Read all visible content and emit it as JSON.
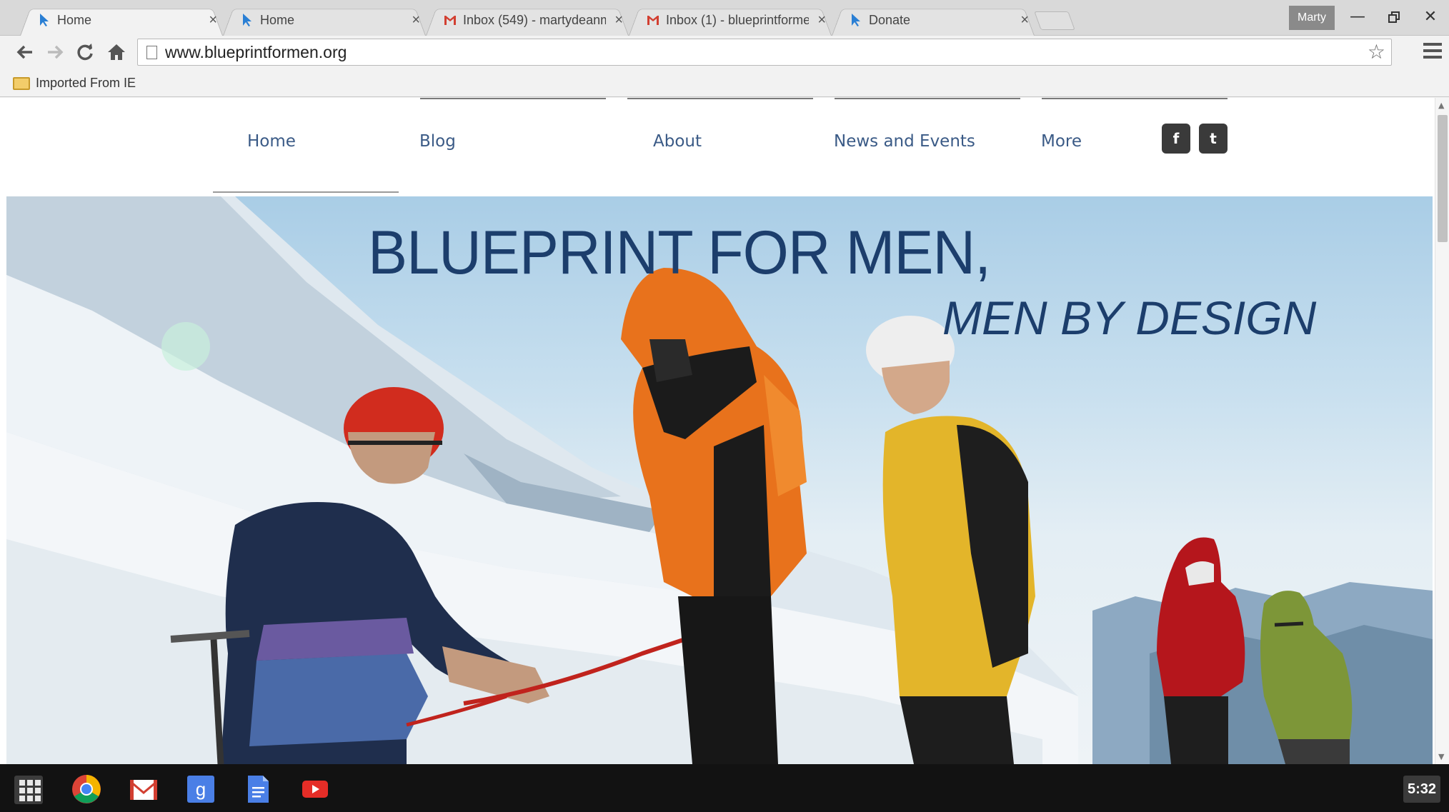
{
  "browser": {
    "tabs": [
      {
        "title": "Home",
        "icon": "blueprint-arrow-icon",
        "active": true
      },
      {
        "title": "Home",
        "icon": "blueprint-arrow-icon",
        "active": false
      },
      {
        "title": "Inbox (549) - martydeanm",
        "icon": "gmail-icon",
        "active": false
      },
      {
        "title": "Inbox (1) - blueprintforme",
        "icon": "gmail-icon",
        "active": false
      },
      {
        "title": "Donate",
        "icon": "blueprint-arrow-icon",
        "active": false
      }
    ],
    "close_glyph": "×",
    "profile_name": "Marty",
    "url": "www.blueprintformen.org",
    "bookmark": "Imported From IE"
  },
  "site": {
    "nav": [
      "Home",
      "Blog",
      "About",
      "News and Events",
      "More"
    ],
    "social": {
      "facebook": "f",
      "twitter": "t"
    },
    "hero_title": "BLUEPRINT FOR MEN,",
    "hero_subtitle": "MEN BY DESIGN",
    "colors": {
      "nav_text": "#3a5a86",
      "hero_text": "#1c3e6c"
    }
  },
  "shelf": {
    "apps": [
      "chrome-icon",
      "gmail-icon",
      "google-search-icon",
      "docs-icon",
      "youtube-icon"
    ],
    "clock": "5:32"
  }
}
